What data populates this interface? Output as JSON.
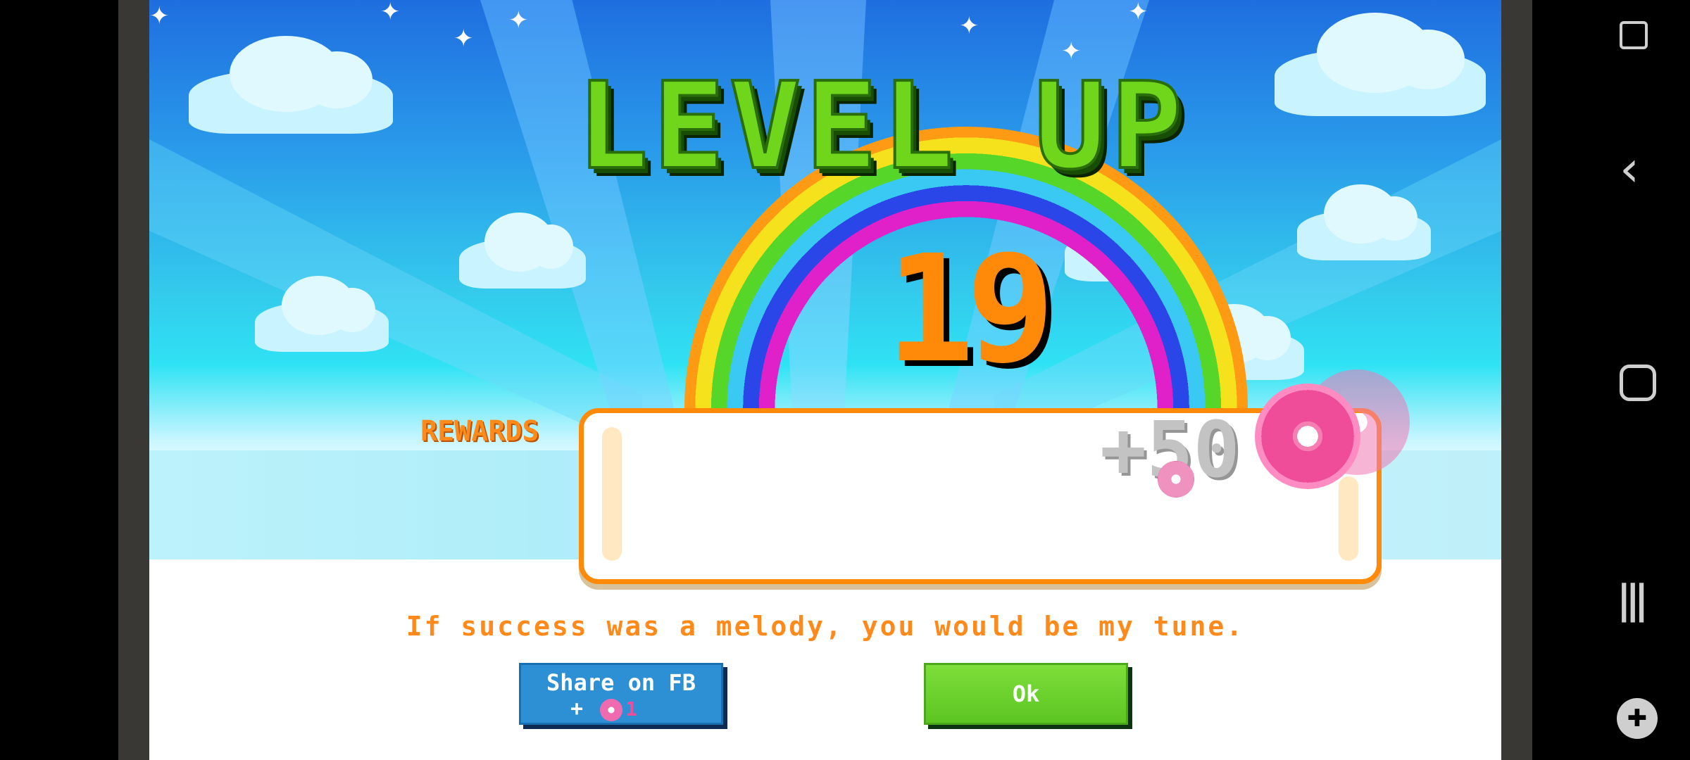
{
  "game": {
    "title": "LEVEL UP",
    "level": "19",
    "rewards_label": "REWARDS",
    "reward_amount": "+50",
    "quote": "If success was a melody, you would be my tune.",
    "share_button": {
      "label": "Share on FB",
      "bonus_prefix": "+",
      "bonus_amount": "1"
    },
    "ok_button": {
      "label": "Ok"
    },
    "colors": {
      "title_green": "#6fd61b",
      "level_orange": "#ff8a0a",
      "reward_border": "#ff8a0a",
      "fb_blue": "#2d8fd4",
      "ok_green": "#5cc522"
    }
  },
  "system_nav": {
    "icons": [
      "screen-lock-icon",
      "back-icon",
      "home-icon",
      "recents-icon",
      "game-tools-icon"
    ]
  }
}
